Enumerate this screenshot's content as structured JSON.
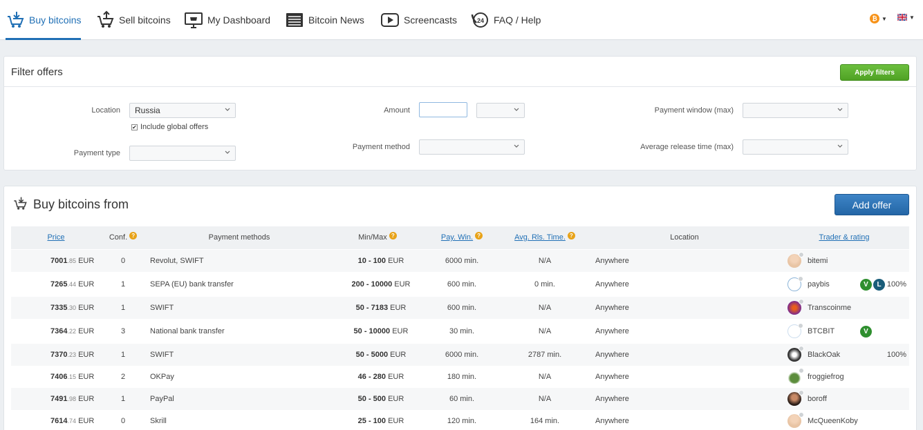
{
  "nav": {
    "items": [
      {
        "label": "Buy bitcoins",
        "icon": "buy-cart-icon"
      },
      {
        "label": "Sell bitcoins",
        "icon": "sell-cart-icon"
      },
      {
        "label": "My Dashboard",
        "icon": "dashboard-monitor-icon"
      },
      {
        "label": "Bitcoin News",
        "icon": "newspaper-icon"
      },
      {
        "label": "Screencasts",
        "icon": "play-icon"
      },
      {
        "label": "FAQ / Help",
        "icon": "support-24-icon"
      }
    ],
    "currency_symbol": "₿",
    "language": "en-GB"
  },
  "filters": {
    "title": "Filter offers",
    "apply_label": "Apply filters",
    "location_label": "Location",
    "location_value": "Russia",
    "include_global_label": "Include global offers",
    "include_global_checked": true,
    "payment_type_label": "Payment type",
    "amount_label": "Amount",
    "payment_method_label": "Payment method",
    "payment_window_label": "Payment window (max)",
    "avg_release_label": "Average release time (max)"
  },
  "offers": {
    "title": "Buy bitcoins from",
    "add_offer_label": "Add offer",
    "columns": {
      "price": "Price",
      "conf": "Conf.",
      "methods": "Payment methods",
      "minmax": "Min/Max",
      "paywin": "Pay. Win.",
      "avgrls": "Avg. Rls. Time.",
      "location": "Location",
      "trader": "Trader & rating"
    },
    "rows": [
      {
        "price_main": "7001",
        "price_dec": ".85",
        "cur": "EUR",
        "conf": "0",
        "methods": "Revolut, SWIFT",
        "range": "10 - 100",
        "range_cur": "EUR",
        "paywin": "6000 min.",
        "avgrls": "N/A",
        "location": "Anywhere",
        "trader": "bitemi",
        "badges": [],
        "rating": ""
      },
      {
        "price_main": "7265",
        "price_dec": ".44",
        "cur": "EUR",
        "conf": "1",
        "methods": "SEPA (EU) bank transfer",
        "range": "200 - 10000",
        "range_cur": "EUR",
        "paywin": "600 min.",
        "avgrls": "0 min.",
        "location": "Anywhere",
        "trader": "paybis",
        "badges": [
          "V",
          "L"
        ],
        "rating": "100%"
      },
      {
        "price_main": "7335",
        "price_dec": ".30",
        "cur": "EUR",
        "conf": "1",
        "methods": "SWIFT",
        "range": "50 - 7183",
        "range_cur": "EUR",
        "paywin": "600 min.",
        "avgrls": "N/A",
        "location": "Anywhere",
        "trader": "Transcoinme",
        "badges": [],
        "rating": ""
      },
      {
        "price_main": "7364",
        "price_dec": ".22",
        "cur": "EUR",
        "conf": "3",
        "methods": "National bank transfer",
        "range": "50 - 10000",
        "range_cur": "EUR",
        "paywin": "30 min.",
        "avgrls": "N/A",
        "location": "Anywhere",
        "trader": "BTCBIT",
        "badges": [
          "V"
        ],
        "rating": ""
      },
      {
        "price_main": "7370",
        "price_dec": ".23",
        "cur": "EUR",
        "conf": "1",
        "methods": "SWIFT",
        "range": "50 - 5000",
        "range_cur": "EUR",
        "paywin": "6000 min.",
        "avgrls": "2787 min.",
        "location": "Anywhere",
        "trader": "BlackOak",
        "badges": [],
        "rating": "100%"
      },
      {
        "price_main": "7406",
        "price_dec": ".15",
        "cur": "EUR",
        "conf": "2",
        "methods": "OKPay",
        "range": "46 - 280",
        "range_cur": "EUR",
        "paywin": "180 min.",
        "avgrls": "N/A",
        "location": "Anywhere",
        "trader": "froggiefrog",
        "badges": [],
        "rating": ""
      },
      {
        "price_main": "7491",
        "price_dec": ".98",
        "cur": "EUR",
        "conf": "1",
        "methods": "PayPal",
        "range": "50 - 500",
        "range_cur": "EUR",
        "paywin": "60 min.",
        "avgrls": "N/A",
        "location": "Anywhere",
        "trader": "boroff",
        "badges": [],
        "rating": ""
      },
      {
        "price_main": "7614",
        "price_dec": ".74",
        "cur": "EUR",
        "conf": "0",
        "methods": "Skrill",
        "range": "25 - 100",
        "range_cur": "EUR",
        "paywin": "120 min.",
        "avgrls": "164 min.",
        "location": "Anywhere",
        "trader": "McQueenKoby",
        "badges": [],
        "rating": ""
      }
    ]
  },
  "colors": {
    "accent": "#1f6fb5",
    "apply_green": "#5ab02f",
    "add_blue": "#2d74b8",
    "badge_v": "#2f8f2f",
    "badge_l": "#1a5d7a",
    "help_orange": "#e8a319"
  }
}
